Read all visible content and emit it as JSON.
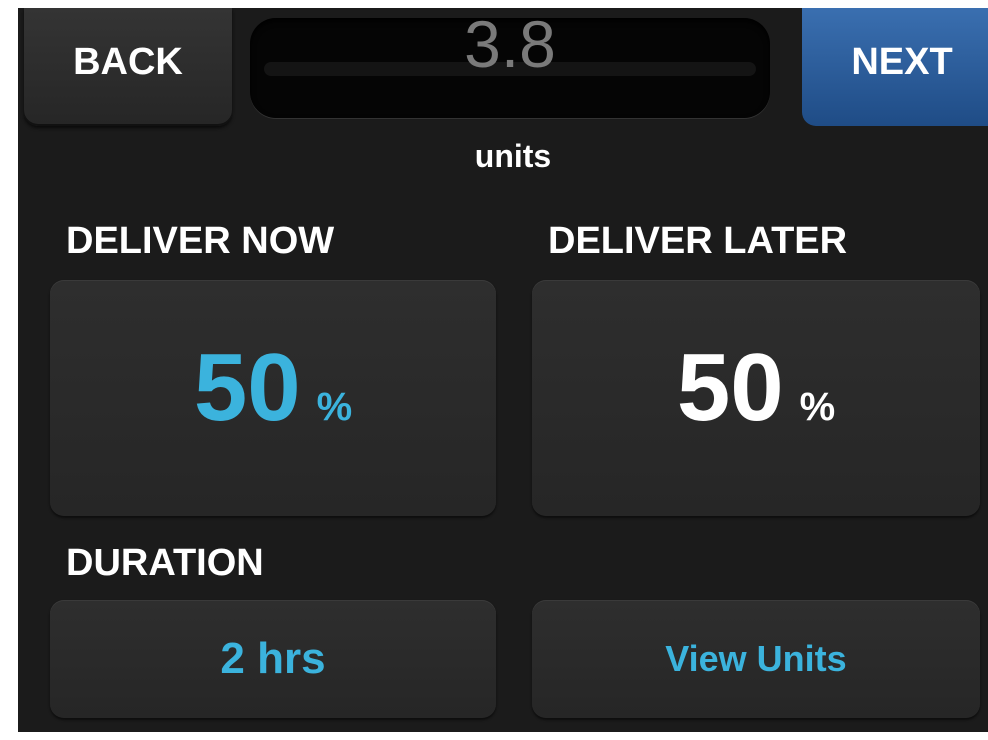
{
  "header": {
    "back_label": "BACK",
    "next_label": "NEXT",
    "display_value": "3.8",
    "display_units": "units"
  },
  "deliver_now": {
    "label": "DELIVER NOW",
    "value": "50",
    "unit": "%"
  },
  "deliver_later": {
    "label": "DELIVER LATER",
    "value": "50",
    "unit": "%"
  },
  "duration": {
    "label": "DURATION",
    "value": "2 hrs"
  },
  "view_units": {
    "label": "View Units"
  },
  "colors": {
    "background": "#1b1b1b",
    "accent_blue": "#3bb3dd",
    "next_button": "#2a5d9c",
    "display_text": "#7a7a7a"
  }
}
